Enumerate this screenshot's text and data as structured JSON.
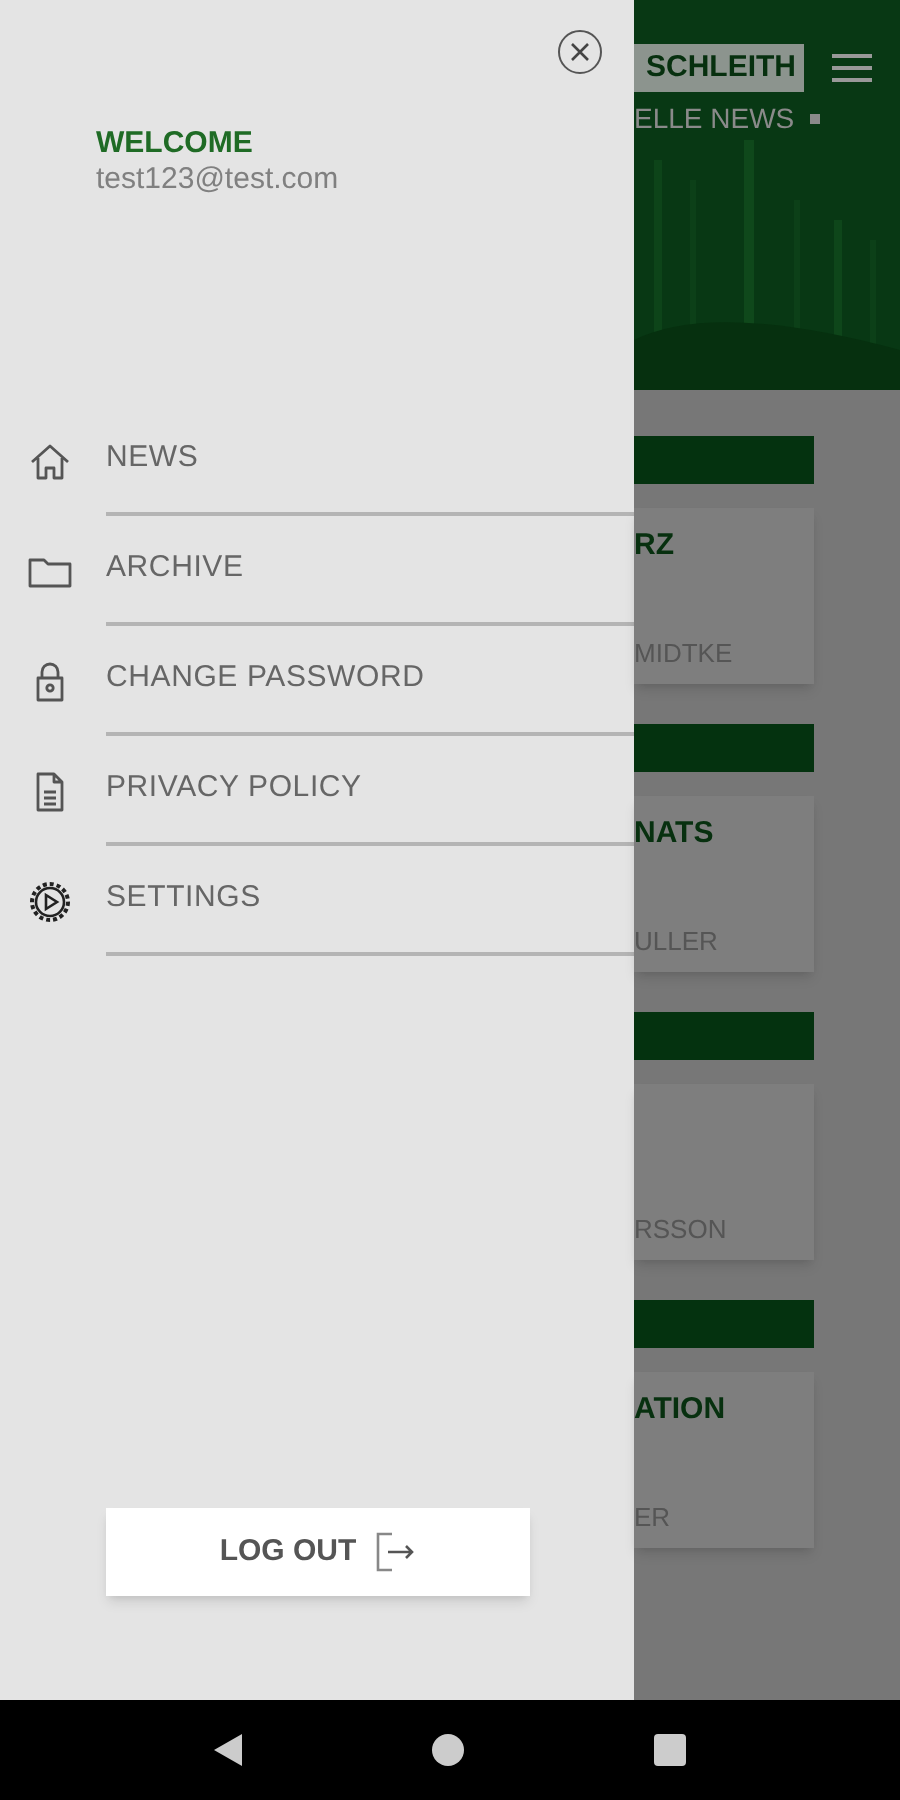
{
  "drawer": {
    "welcome": "WELCOME",
    "email": "test123@test.com",
    "menu": [
      {
        "label": "NEWS",
        "kind": "home"
      },
      {
        "label": "ARCHIVE",
        "kind": "folder"
      },
      {
        "label": "CHANGE PASSWORD",
        "kind": "lock"
      },
      {
        "label": "PRIVACY POLICY",
        "kind": "document"
      },
      {
        "label": "SETTINGS",
        "kind": "settings"
      }
    ],
    "logout": "LOG OUT"
  },
  "background": {
    "title": "SCHLEITH",
    "subtitle": "ELLE NEWS",
    "articles": [
      {
        "title": "RZ",
        "author": "MIDTKE"
      },
      {
        "title": "NATS",
        "author": "ULLER"
      },
      {
        "author": "RSSON"
      },
      {
        "title": "ATION",
        "author": "ER"
      }
    ]
  }
}
